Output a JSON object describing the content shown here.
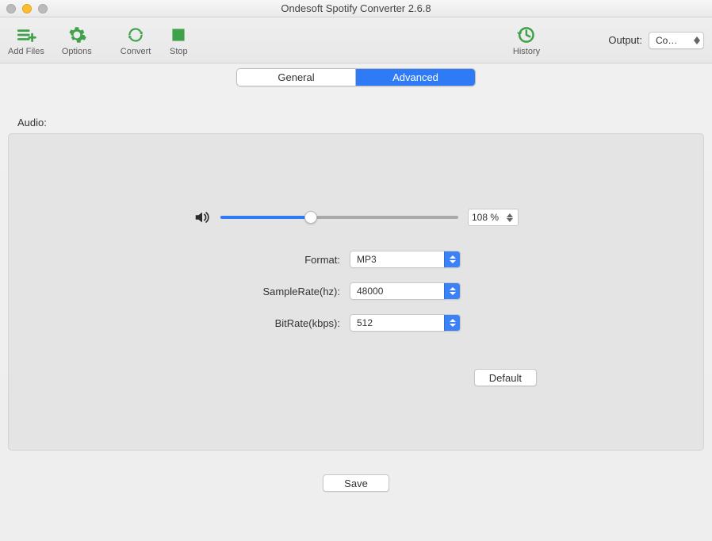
{
  "window": {
    "title": "Ondesoft Spotify Converter 2.6.8"
  },
  "toolbar": {
    "add_files": "Add Files",
    "options": "Options",
    "convert": "Convert",
    "stop": "Stop",
    "history": "History",
    "output_label": "Output:",
    "output_value": "Co…"
  },
  "tabs": {
    "general": "General",
    "advanced": "Advanced",
    "active": "advanced"
  },
  "audio": {
    "section_label": "Audio:",
    "volume_percent": "108 %",
    "volume_slider_fraction": 0.38,
    "format_label": "Format:",
    "format_value": "MP3",
    "samplerate_label": "SampleRate(hz):",
    "samplerate_value": "48000",
    "bitrate_label": "BitRate(kbps):",
    "bitrate_value": "512",
    "default_button": "Default"
  },
  "buttons": {
    "save": "Save"
  }
}
